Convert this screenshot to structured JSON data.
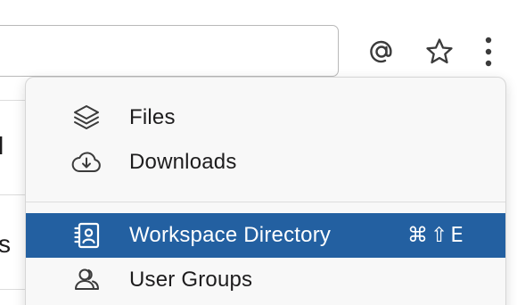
{
  "header": {
    "icons": [
      {
        "name": "mentions-icon",
        "glyph": "at-sign"
      },
      {
        "name": "saved-items-icon",
        "glyph": "star"
      },
      {
        "name": "more-options-icon",
        "glyph": "vertical-ellipsis"
      }
    ]
  },
  "menu": {
    "items": [
      {
        "label": "Files",
        "icon": "layers-icon",
        "shortcut": ""
      },
      {
        "label": "Downloads",
        "icon": "cloud-download-icon",
        "shortcut": ""
      },
      {
        "label": "Workspace Directory",
        "icon": "contact-card-icon",
        "shortcut": "⌘⇧E",
        "active": true
      },
      {
        "label": "User Groups",
        "icon": "user-group-icon",
        "shortcut": ""
      }
    ]
  },
  "colors": {
    "highlight": "#2360a1",
    "menu_background": "#f8f8f8",
    "text": "#1d1c1d"
  }
}
